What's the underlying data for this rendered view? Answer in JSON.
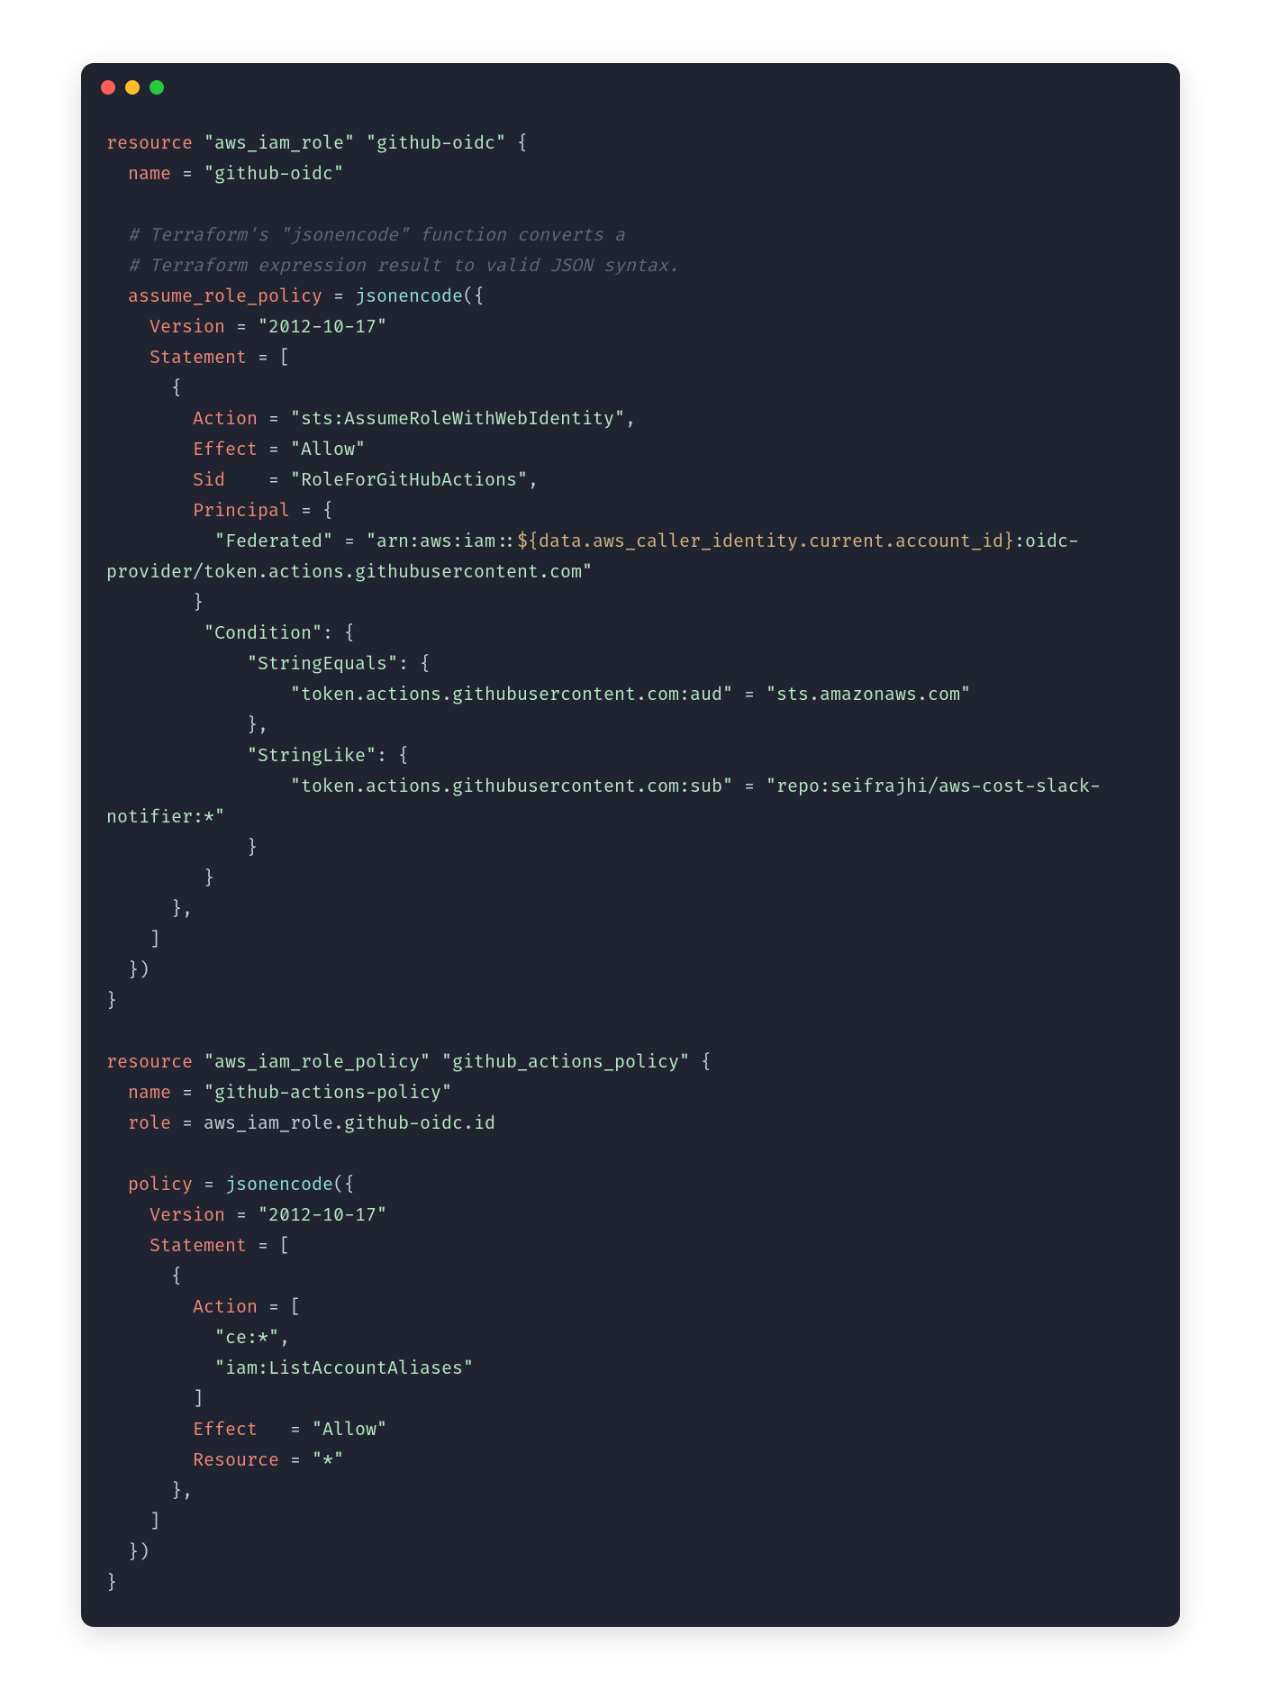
{
  "window": {
    "traffic_lights": [
      "close",
      "minimize",
      "zoom"
    ]
  },
  "code": {
    "language": "terraform",
    "resource1": {
      "keyword": "resource",
      "type": "\"aws_iam_role\"",
      "name": "\"github-oidc\"",
      "open": " {",
      "name_attr": "name",
      "name_eq": " = ",
      "name_val": "\"github-oidc\"",
      "comment1": "# Terraform's \"jsonencode\" function converts a",
      "comment2": "# Terraform expression result to valid JSON syntax.",
      "arp_attr": "assume_role_policy",
      "arp_eq": " = ",
      "arp_fn": "jsonencode",
      "arp_open": "({",
      "version_attr": "Version",
      "version_eq": " = ",
      "version_val": "\"2012-10-17\"",
      "stmt_attr": "Statement",
      "stmt_eq": " = [",
      "stmt_open": "{",
      "action_attr": "Action",
      "action_eq": " = ",
      "action_val": "\"sts:AssumeRoleWithWebIdentity\"",
      "action_comma": ",",
      "effect_attr": "Effect",
      "effect_eq": " = ",
      "effect_val": "\"Allow\"",
      "sid_attr": "Sid",
      "sid_eq": "    = ",
      "sid_val": "\"RoleForGitHubActions\"",
      "sid_comma": ",",
      "principal_attr": "Principal",
      "principal_eq": " = {",
      "federated_key": "\"Federated\"",
      "federated_eq": " = ",
      "federated_val_a": "\"arn:aws:iam::",
      "federated_val_b": "${data.aws_caller_identity.current.account_id}",
      "federated_val_c": ":oidc-provider/token.actions.githubusercontent.com\"",
      "principal_close": "}",
      "condition_key": "\"Condition\"",
      "condition_colon": ": {",
      "streq_key": "\"StringEquals\"",
      "streq_colon": ": {",
      "streq_k": "\"token.actions.githubusercontent.com:aud\"",
      "streq_eq": " = ",
      "streq_v": "\"sts.amazonaws.com\"",
      "streq_close": "},",
      "strlike_key": "\"StringLike\"",
      "strlike_colon": ": {",
      "strlike_k": "\"token.actions.githubusercontent.com:sub\"",
      "strlike_eq": " = ",
      "strlike_v": "\"repo:seifrajhi/aws-cost-slack-notifier:*\"",
      "strlike_close": "}",
      "condition_close": "}",
      "stmt_obj_close": "},",
      "stmt_close": "]",
      "arp_close": "})",
      "close": "}"
    },
    "resource2": {
      "keyword": "resource",
      "type": "\"aws_iam_role_policy\"",
      "name": "\"github_actions_policy\"",
      "open": " {",
      "name_attr": "name",
      "name_eq": " = ",
      "name_val": "\"github-actions-policy\"",
      "role_attr": "role",
      "role_eq": " = ",
      "role_ref_a": "aws_iam_role",
      "role_ref_dot1": ".",
      "role_ref_b": "github-oidc",
      "role_ref_dot2": ".",
      "role_ref_c": "id",
      "policy_attr": "policy",
      "policy_eq": " = ",
      "policy_fn": "jsonencode",
      "policy_open": "({",
      "version_attr": "Version",
      "version_eq": " = ",
      "version_val": "\"2012-10-17\"",
      "stmt_attr": "Statement",
      "stmt_eq": " = [",
      "stmt_open": "{",
      "action_attr": "Action",
      "action_eq": " = [",
      "action_v1": "\"ce:*\"",
      "action_c1": ",",
      "action_v2": "\"iam:ListAccountAliases\"",
      "action_close": "]",
      "effect_attr": "Effect",
      "effect_eq": "   = ",
      "effect_val": "\"Allow\"",
      "resource_attr": "Resource",
      "resource_eq": " = ",
      "resource_val": "\"*\"",
      "stmt_obj_close": "},",
      "stmt_close": "]",
      "policy_close": "})",
      "close": "}"
    }
  }
}
